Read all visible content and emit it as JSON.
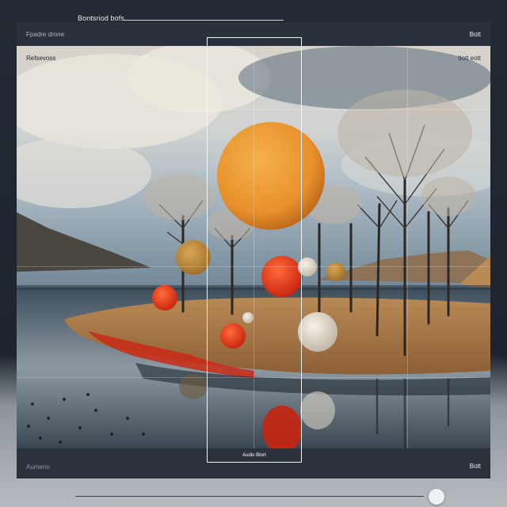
{
  "topbar": {
    "title": "Bontsriod bofs"
  },
  "window": {
    "header_left": "Fpadre drone",
    "header_right": "Bott"
  },
  "canvas": {
    "label_left": "Refsevoss",
    "label_right": "tlott eott"
  },
  "selection": {
    "label": "Audio Btort"
  },
  "footer": {
    "left": "Aumeno",
    "right": "Bott"
  },
  "slider": {
    "value": 0.97
  },
  "icons": {
    "slider_thumb": "circle-handle"
  }
}
